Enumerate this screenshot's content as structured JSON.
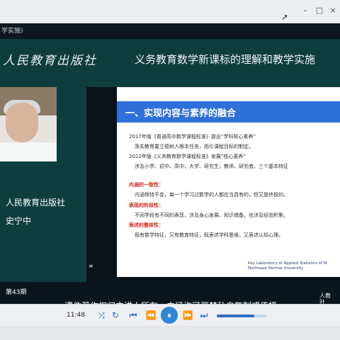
{
  "window": {
    "minimize_glyph": "–",
    "maximize_glyph": "□",
    "close_glyph": "×",
    "cursor_icon": "pointer-cursor-icon"
  },
  "video": {
    "strip_text": "学实施)",
    "banner": {
      "logo_text": "人民教育出版社",
      "title": "义务教育数学新课标的理解和教学实施"
    },
    "presenter": {
      "publisher": "人民教育出版社",
      "speaker": "史宁中"
    },
    "slide": {
      "section_title": "一、实现内容与素养的融合",
      "lines": [
        "2017年版《普通高中数学课程标准》提出“学科核心素养”",
        "落实教育要立德树人根本任务，指引课程目标的制定。",
        "2022年版《义务教育数学课程标准》发展“核心素养”",
        "涉及小学、初中、高中；大学、研究生；教师、研究者，三个基本特征",
        "内涵的一致性：",
        "内涵保持不变，每一个学习过数学的人都应当具有的，但又是终极的。",
        "表现的阶段性：",
        "不同学段有不同的表现，涉及身心发展、知识储备，也涉及经验积累。",
        "表述的整体性：",
        "既有数学特征，又有教育特征，既表述学科思维，又表述认知心理。"
      ],
      "footer": "Key Laboratory of Applied Statistics of M\nNortheast Normal University",
      "mini_marker": "≡"
    },
    "episode": "第43期",
    "copyright": "课件著作权归主讲人所有，未经许可严禁私自复制或传播。",
    "corner_badge": "人教\n社"
  },
  "player": {
    "time": "11:48",
    "buttons": {
      "shuffle": "⤨",
      "loop": "↻",
      "previous": "⏮",
      "rewind": "⏪",
      "play_pause": "⏸",
      "forward": "⏩",
      "next": "⏭",
      "volume": "🔊"
    },
    "volume_level": 0.75
  }
}
